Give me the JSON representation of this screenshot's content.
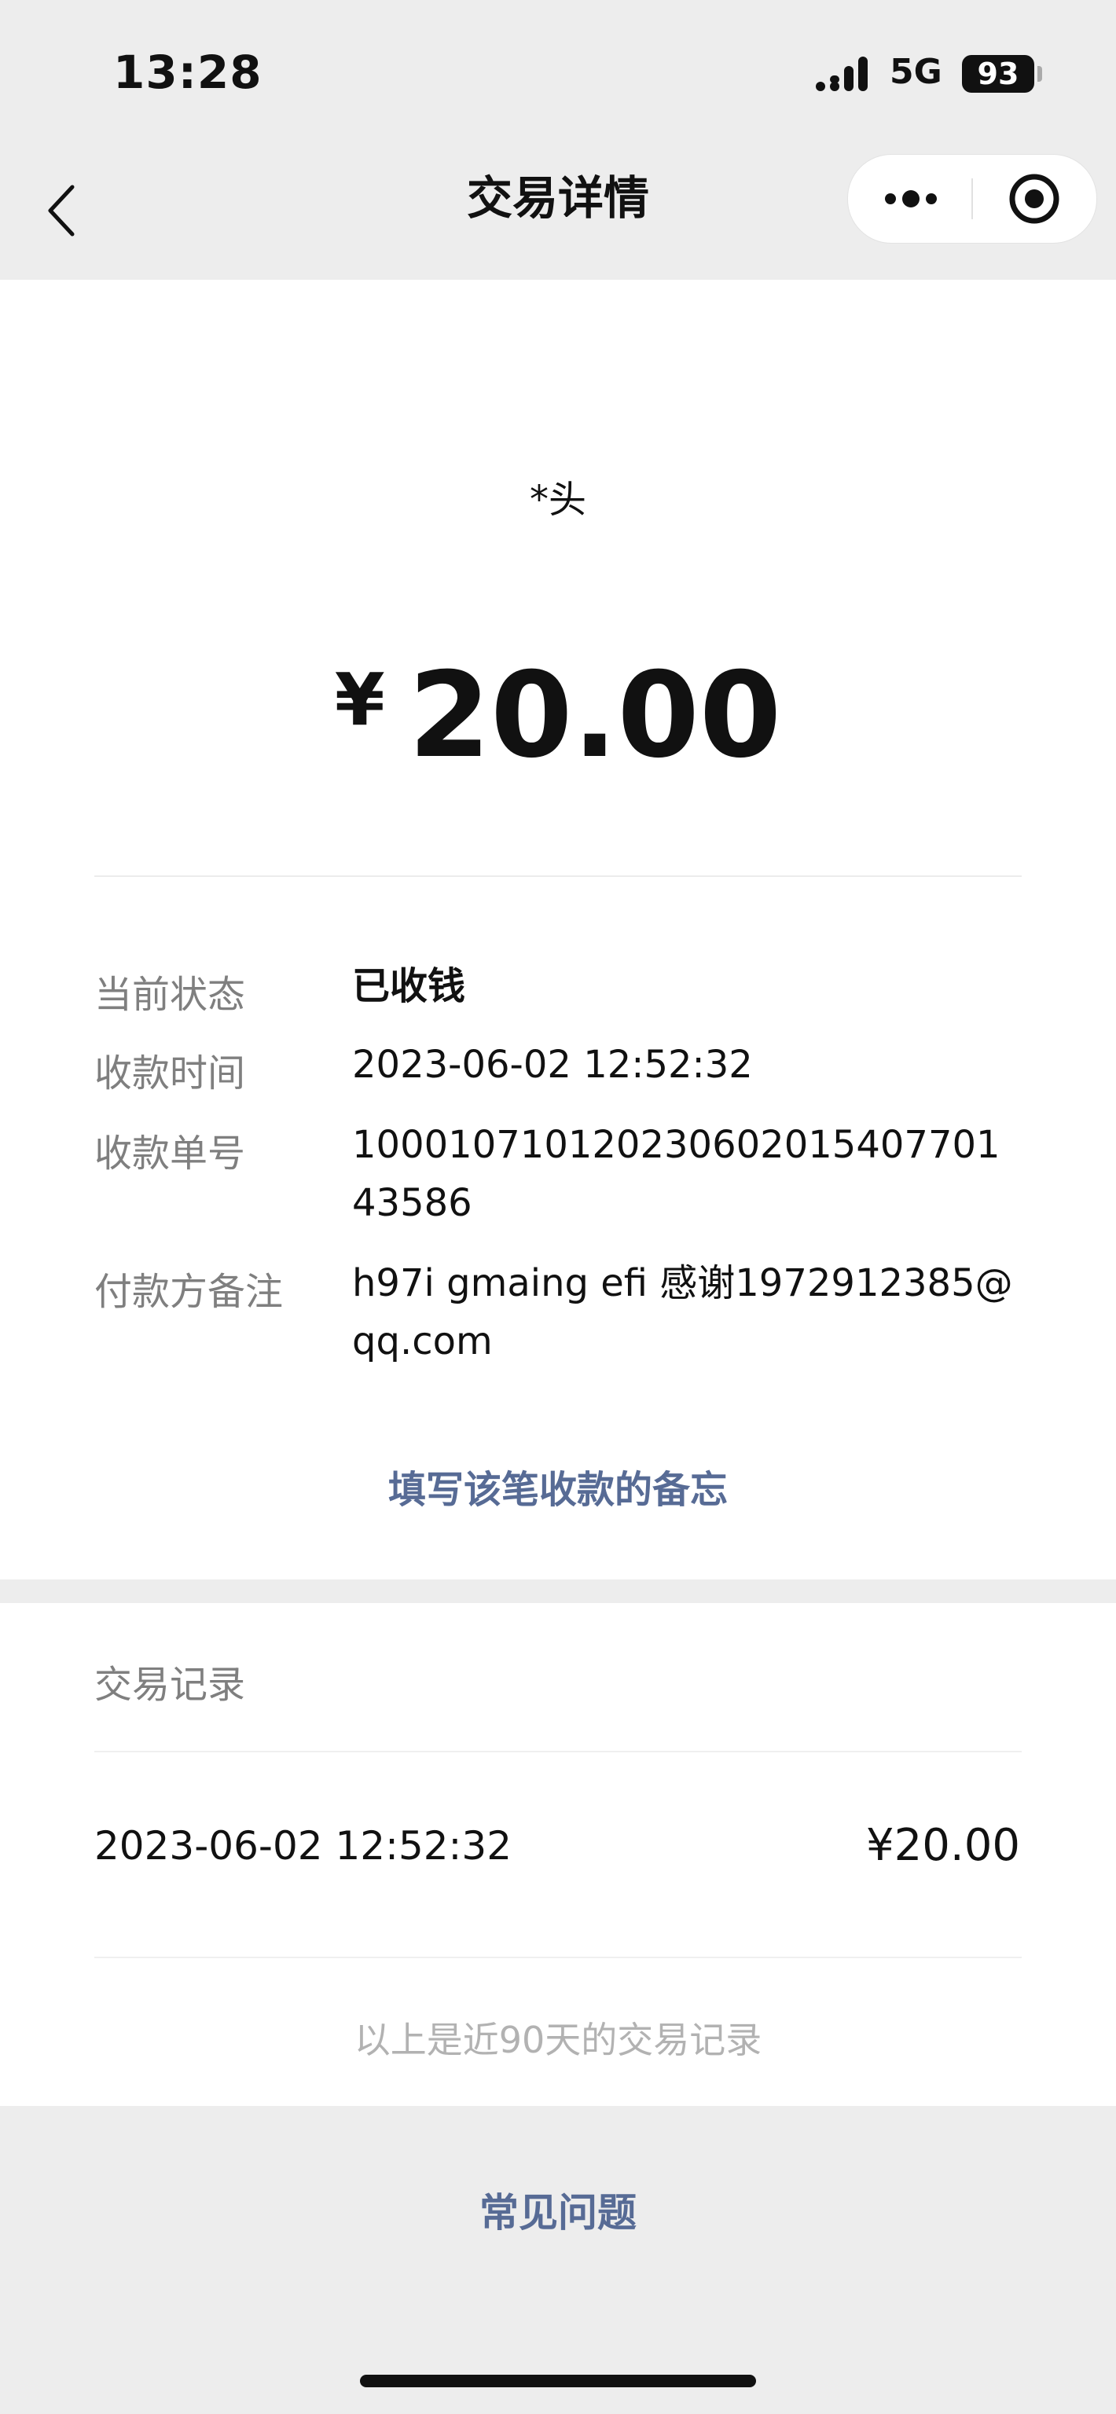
{
  "status_bar": {
    "time": "13:28",
    "network": "5G",
    "battery": "93"
  },
  "nav": {
    "title": "交易详情"
  },
  "transaction": {
    "payer": "*头",
    "currency_symbol": "¥",
    "amount": "20.00",
    "rows": [
      {
        "label": "当前状态",
        "value": "已收钱"
      },
      {
        "label": "收款时间",
        "value": "2023-06-02 12:52:32"
      },
      {
        "label": "收款单号",
        "value": "10001071012023060201540770143586"
      },
      {
        "label": "付款方备注",
        "value": "h97i gmaing efi 感谢1972912385@qq.com"
      }
    ],
    "memo_link": "填写该笔收款的备忘"
  },
  "records": {
    "title": "交易记录",
    "items": [
      {
        "time": "2023-06-02 12:52:32",
        "amount": "¥20.00"
      }
    ],
    "note": "以上是近90天的交易记录"
  },
  "footer": {
    "faq": "常见问题"
  },
  "colors": {
    "link": "#576b95",
    "page_bg": "#ededed",
    "card_bg": "#ffffff"
  },
  "icons": [
    "signal-icon",
    "back-icon",
    "more-icon",
    "close-mini-program-icon"
  ]
}
